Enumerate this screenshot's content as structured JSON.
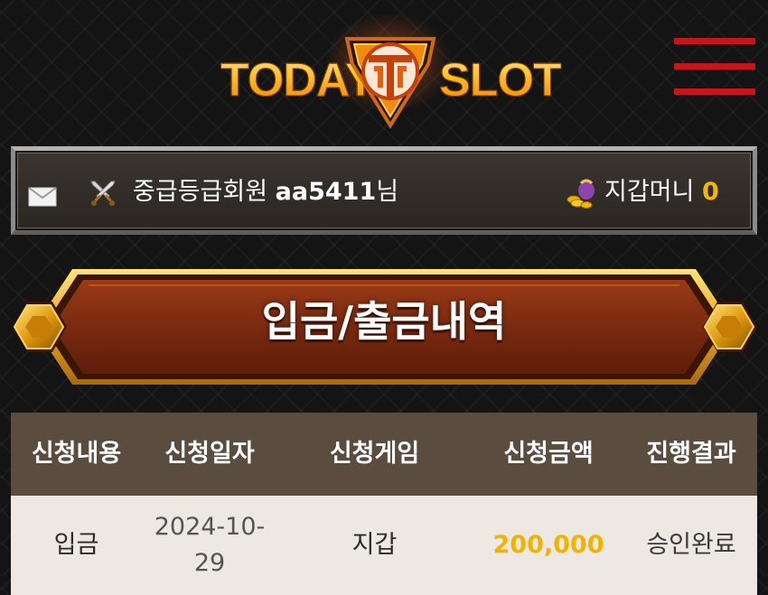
{
  "header": {
    "logo_left": "TODAY",
    "logo_right": "SLOT",
    "menu_icon": "hamburger-menu-icon"
  },
  "userbar": {
    "mail_icon": "envelope-icon",
    "grade_icon": "crossed-swords-icon",
    "grade": "중급등급회원",
    "user_id": "aa5411",
    "suffix": "님",
    "wallet_icon": "coins-pouch-icon",
    "wallet_label": "지갑머니",
    "wallet_amount": "0"
  },
  "banner": {
    "title": "입금/출금내역"
  },
  "table": {
    "headers": [
      "신청내용",
      "신청일자",
      "신청게임",
      "신청금액",
      "진행결과"
    ],
    "rows": [
      {
        "type": "입금",
        "date_line1": "2024-10-",
        "date_line2": "29",
        "game": "지갑",
        "amount": "200,000",
        "status": "승인완료"
      }
    ]
  },
  "colors": {
    "accent_gold": "#f5b800",
    "menu_red": "#c4161c",
    "banner_brown": "#7a2d12",
    "table_header": "#5a4d40",
    "table_row": "#ede8e2"
  }
}
